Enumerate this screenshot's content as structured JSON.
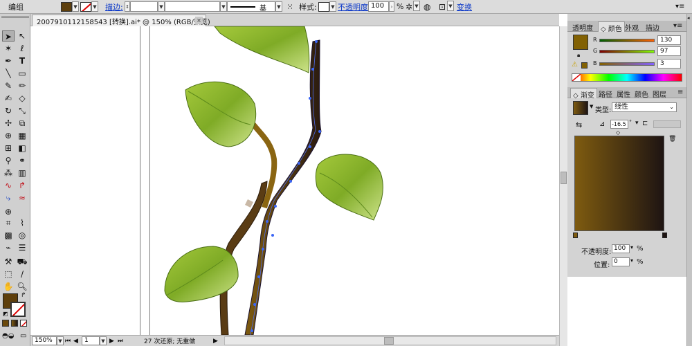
{
  "control_bar": {
    "object_type": "编组",
    "stroke_label": "描边:",
    "stroke_weight_value": "",
    "stroke_profile_value": "",
    "brush_value": "基本",
    "style_label": "样式:",
    "opacity_label": "不透明度:",
    "opacity_value": "100",
    "opacity_unit": "%",
    "transform_label": "变换"
  },
  "document": {
    "tab_title": "2007910112158543 [转换].ai* @ 150% (RGB/预览)",
    "close_glyph": "×"
  },
  "status_bar": {
    "zoom_value": "150%",
    "artboard_value": "1",
    "status_text": "27 次还原; 无重做"
  },
  "color_panel": {
    "tabs": [
      "透明度",
      "颜色",
      "外观",
      "描边"
    ],
    "active_tab": "颜色",
    "channels": [
      {
        "letter": "R",
        "value": "130"
      },
      {
        "letter": "G",
        "value": "97"
      },
      {
        "letter": "B",
        "value": "3"
      }
    ],
    "fill_color": "#826103"
  },
  "gradient_panel": {
    "tabs": [
      "渐变",
      "路径",
      "属性",
      "颜色",
      "图层"
    ],
    "active_tab": "渐变",
    "type_label": "类型:",
    "type_value": "线性",
    "angle_value": "-16.5",
    "angle_unit": "°",
    "opacity_label": "不透明度:",
    "opacity_value": "100",
    "opacity_unit": "%",
    "location_label": "位置:",
    "location_value": "0",
    "location_unit": "%",
    "gradient_start": "#7e5b10",
    "gradient_end": "#1e1412"
  },
  "icons": {
    "fill_swatch": "#5e3f0c",
    "accent_link": "#0a37c8"
  }
}
